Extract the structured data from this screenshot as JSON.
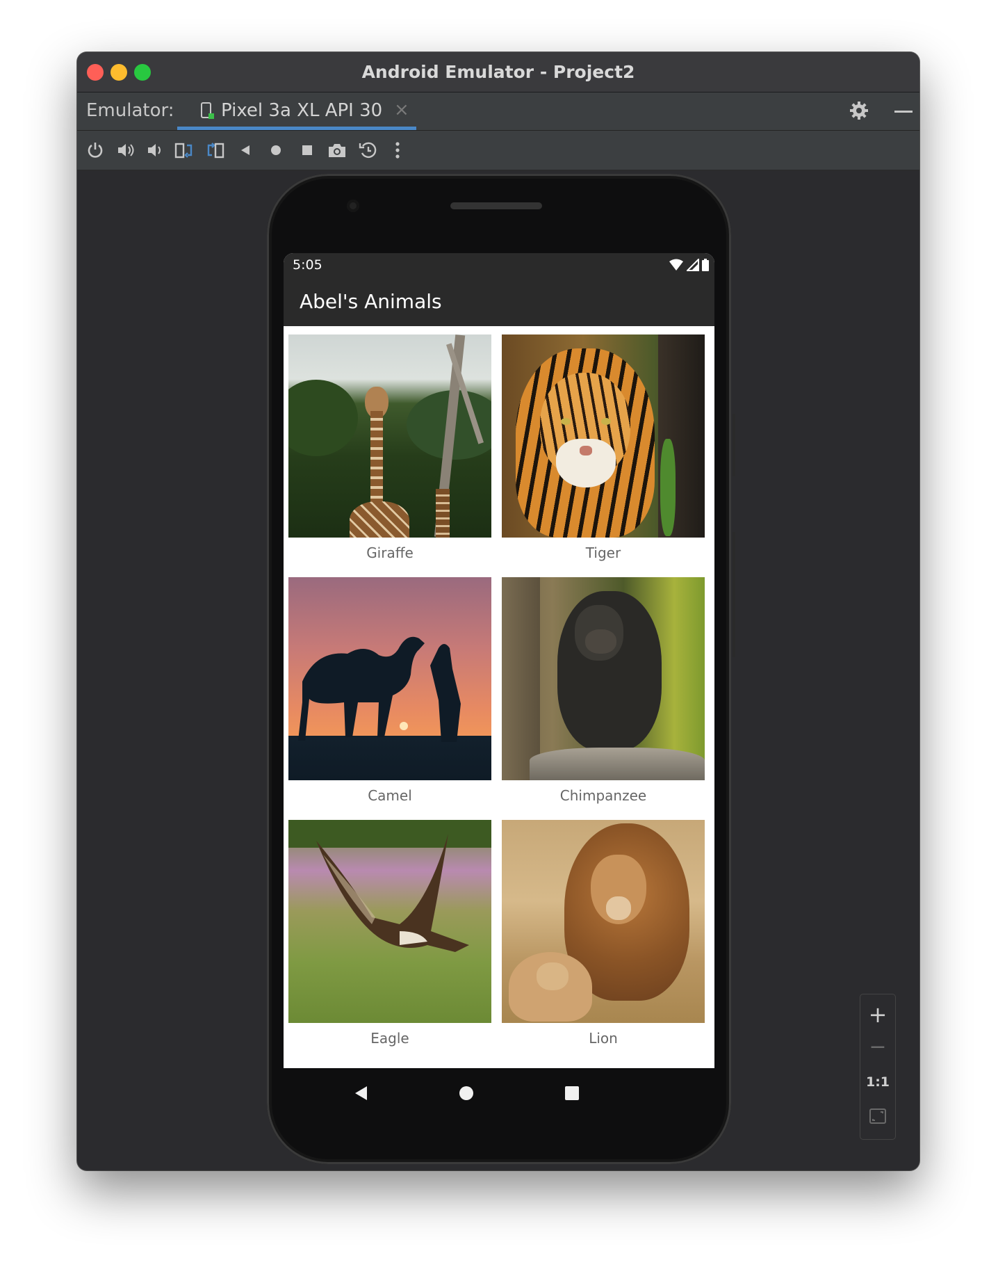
{
  "window": {
    "title": "Android Emulator - Project2",
    "colors": {
      "close": "#ff5f57",
      "minimize": "#febc2e",
      "zoom": "#28c840",
      "accent": "#4a88c7"
    }
  },
  "tabbar": {
    "label": "Emulator:",
    "tab_title": "Pixel 3a XL API 30",
    "close_symbol": "×"
  },
  "toolbar": {
    "icons": [
      "power-icon",
      "volume-up-icon",
      "volume-down-icon",
      "rotate-left-icon",
      "rotate-right-icon",
      "back-icon",
      "home-icon",
      "overview-icon",
      "screenshot-icon",
      "snapshot-icon",
      "more-icon"
    ]
  },
  "device": {
    "status": {
      "time": "5:05"
    },
    "app": {
      "title": "Abel's Animals",
      "animals": [
        {
          "name": "Giraffe"
        },
        {
          "name": "Tiger"
        },
        {
          "name": "Camel"
        },
        {
          "name": "Chimpanzee"
        },
        {
          "name": "Eagle"
        },
        {
          "name": "Lion"
        }
      ]
    }
  },
  "zoom_controls": {
    "zoom_in": "+",
    "zoom_out": "−",
    "actual_size": "1:1"
  }
}
